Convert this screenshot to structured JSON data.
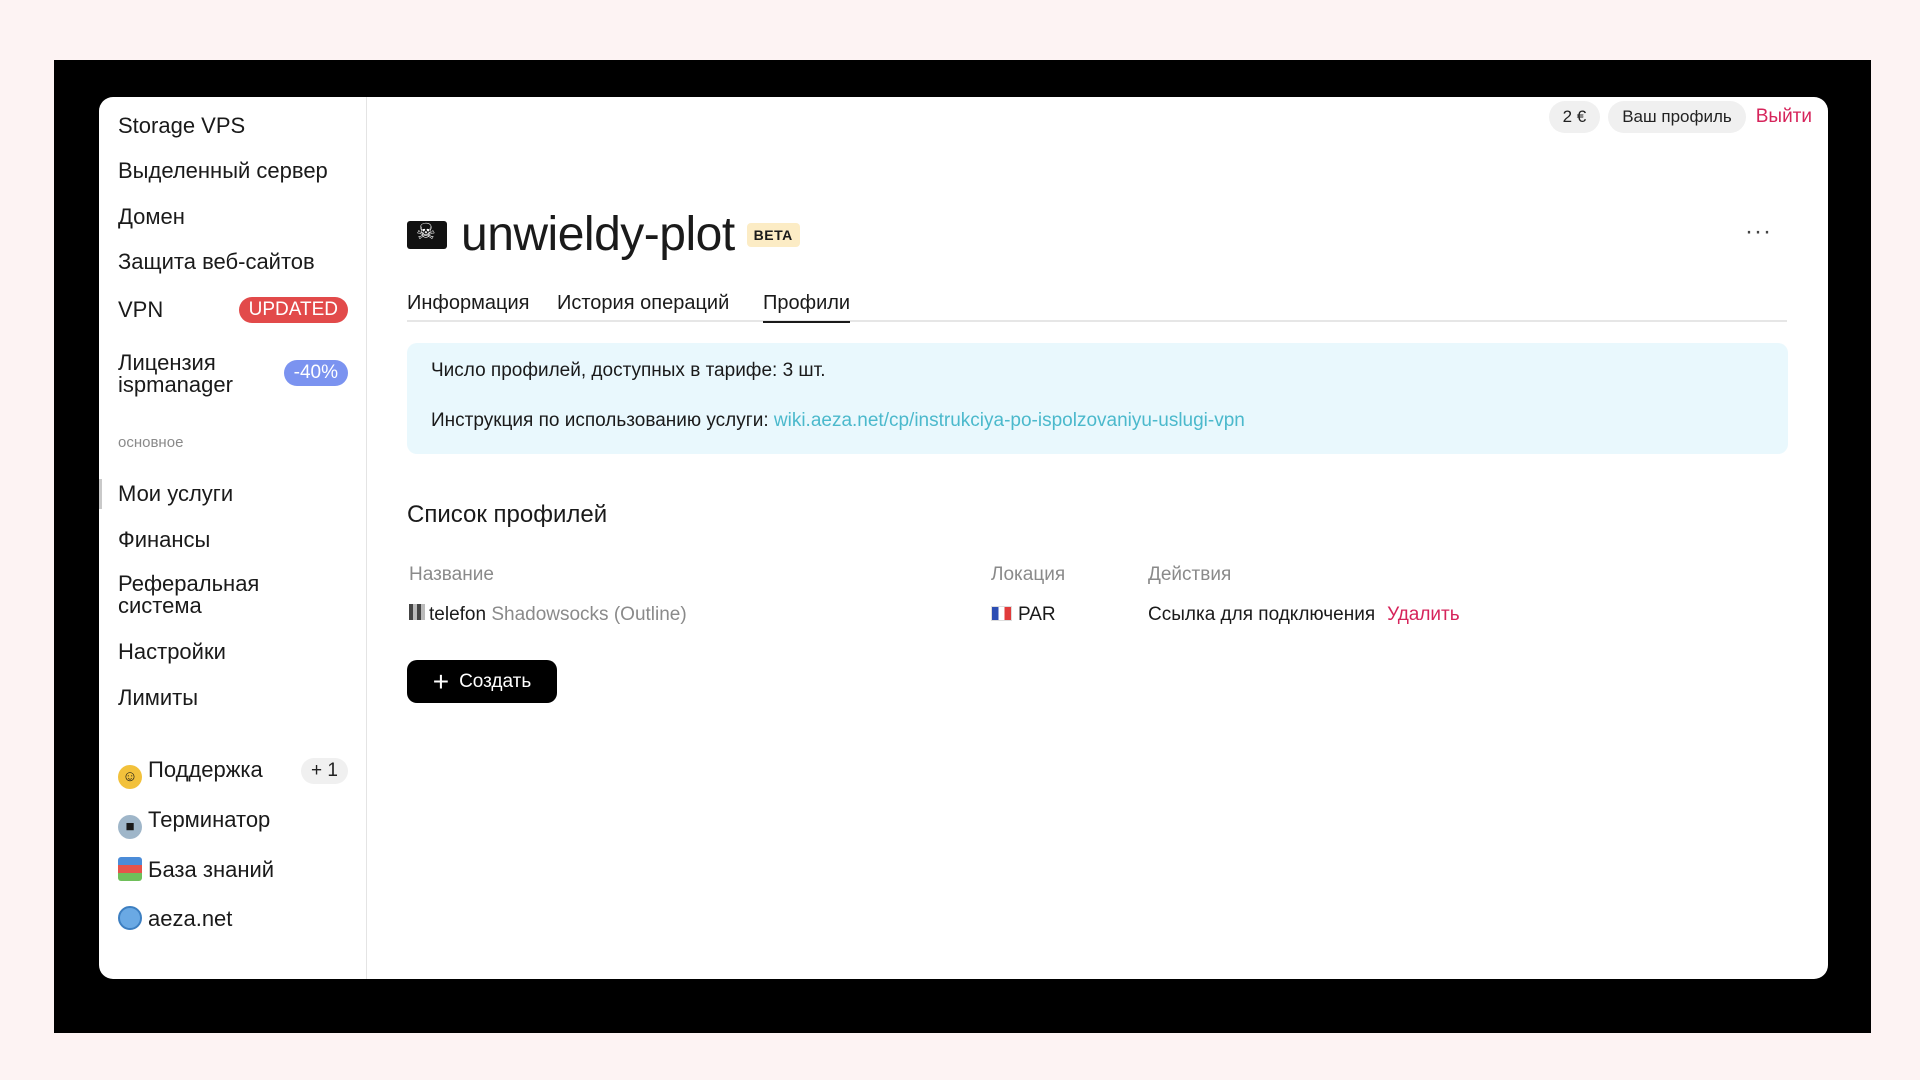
{
  "sidebar": {
    "products": [
      {
        "label": "Storage VPS"
      },
      {
        "label": "Выделенный сервер"
      },
      {
        "label": "Домен"
      },
      {
        "label": "Защита веб-сайтов"
      },
      {
        "label": "VPN",
        "badge": "UPDATED"
      },
      {
        "label_line1": "Лицензия",
        "label_line2": "ispmanager",
        "badge": "-40%"
      }
    ],
    "section_label": "основное",
    "main_items": [
      {
        "label": "Мои услуги"
      },
      {
        "label": "Финансы"
      },
      {
        "label_line1": "Реферальная",
        "label_line2": "система"
      },
      {
        "label": "Настройки"
      },
      {
        "label": "Лимиты"
      }
    ],
    "extra_items": [
      {
        "label": "Поддержка",
        "icon": "nerd-face-icon",
        "badge": "+ 1"
      },
      {
        "label": "Терминатор",
        "icon": "robot-icon"
      },
      {
        "label": "База знаний",
        "icon": "books-icon"
      },
      {
        "label": "aeza.net",
        "icon": "globe-icon"
      }
    ]
  },
  "topbar": {
    "balance": "2 €",
    "profile": "Ваш профиль",
    "logout": "Выйти"
  },
  "page": {
    "title": "unwieldy-plot",
    "badge": "BETA",
    "more": "···",
    "tabs": [
      {
        "label": "Информация"
      },
      {
        "label": "История операций"
      },
      {
        "label": "Профили"
      }
    ],
    "active_tab": "Профили",
    "info": {
      "line1": "Число профилей, доступных в тарифе: 3 шт.",
      "line2_prefix": "Инструкция по использованию услуги: ",
      "line2_link": "wiki.aeza.net/cp/instrukciya-po-ispolzovaniyu-uslugi-vpn"
    },
    "list_title": "Список профилей",
    "table": {
      "headers": {
        "name": "Название",
        "location": "Локация",
        "actions": "Действия"
      },
      "rows": [
        {
          "name": "telefon",
          "type": "Shadowsocks (Outline)",
          "location": "PAR",
          "action_link": "Ссылка для подключения",
          "action_delete": "Удалить"
        }
      ]
    },
    "create_button": "Создать"
  },
  "colors": {
    "accent_red": "#d6245b",
    "link_cyan": "#4bb9cc",
    "info_bg": "#e9f8fd",
    "badge_updated": "#e24a4a",
    "badge_sale": "#7b93f0"
  }
}
